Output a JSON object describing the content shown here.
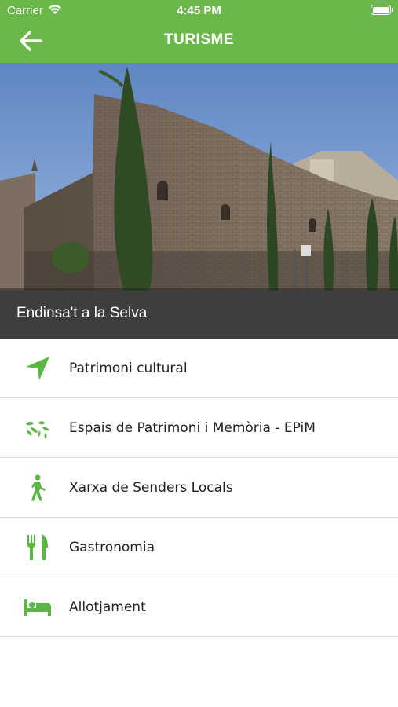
{
  "status_bar": {
    "carrier": "Carrier",
    "time": "4:45 PM"
  },
  "header": {
    "title": "TURISME",
    "back_icon": "arrow-left-icon"
  },
  "hero": {
    "caption": "Endinsa't a la Selva"
  },
  "colors": {
    "accent": "#6ab84a",
    "icon_green": "#5bb646"
  },
  "menu": [
    {
      "label": "Patrimoni cultural",
      "icon": "location-arrow-icon"
    },
    {
      "label": "Espais de Patrimoni i Memòria - EPiM",
      "icon": "leaves-icon"
    },
    {
      "label": "Xarxa de Senders Locals",
      "icon": "walking-person-icon"
    },
    {
      "label": "Gastronomia",
      "icon": "fork-knife-icon"
    },
    {
      "label": "Allotjament",
      "icon": "bed-icon"
    }
  ]
}
